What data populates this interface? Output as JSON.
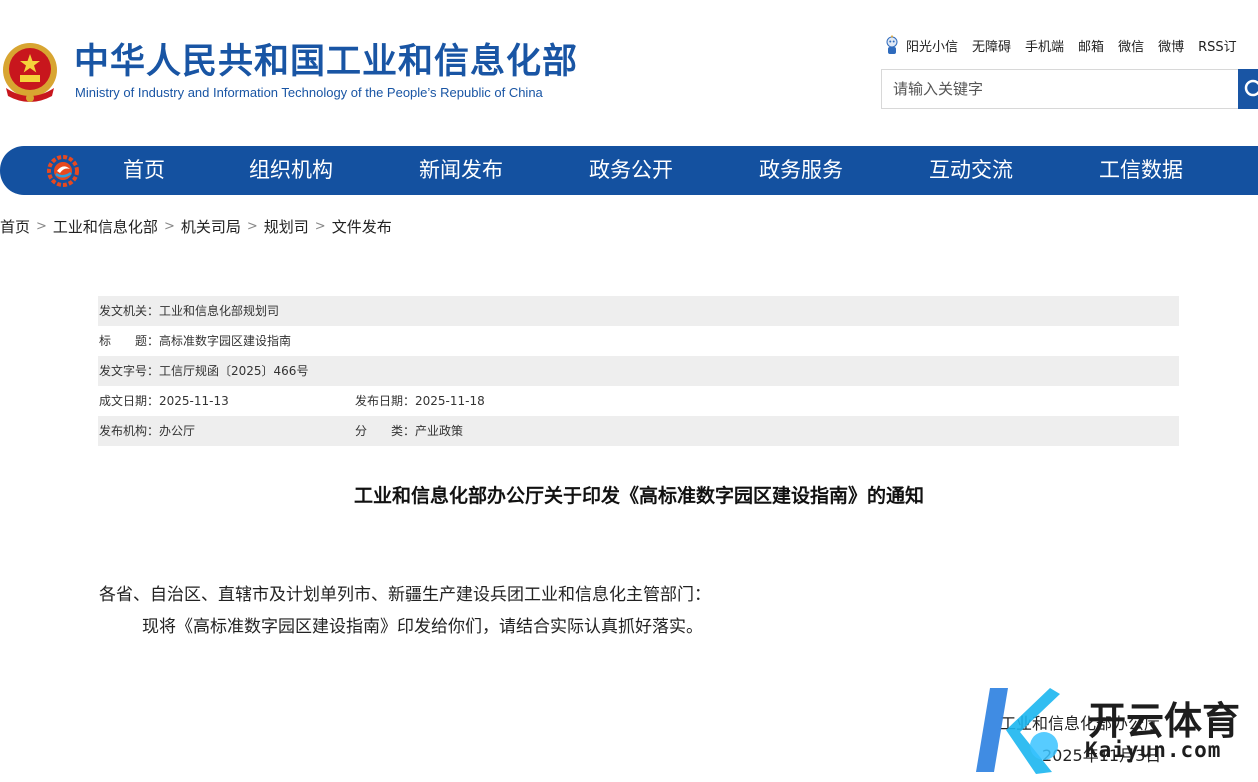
{
  "header": {
    "title": "中华人民共和国工业和信息化部",
    "subtitle": "Ministry of Industry and Information Technology of the People’s Republic of China",
    "top_links": [
      "阳光小信",
      "无障碍",
      "手机端",
      "邮箱",
      "微信",
      "微博",
      "RSS订"
    ]
  },
  "search": {
    "placeholder": "请输入关键字"
  },
  "nav": {
    "items": [
      "首页",
      "组织机构",
      "新闻发布",
      "政务公开",
      "政务服务",
      "互动交流",
      "工信数据"
    ]
  },
  "breadcrumb": [
    "首页",
    "工业和信息化部",
    "机关司局",
    "规划司",
    "文件发布"
  ],
  "info": {
    "issuer": "发文机关：工业和信息化部规划司",
    "title": "标　　题：高标准数字园区建设指南",
    "doc_no": "发文字号：工信厅规函〔2025〕466号",
    "created": "成文日期：2025-11-13",
    "published": "发布日期：2025-11-18",
    "org": "发布机构：办公厅",
    "category": "分　　类：产业政策"
  },
  "article": {
    "title": "工业和信息化部办公厅关于印发《高标准数字园区建设指南》的通知",
    "recipients": "各省、自治区、直辖市及计划单列市、新疆生产建设兵团工业和信息化主管部门：",
    "body": "现将《高标准数字园区建设指南》印发给你们，请结合实际认真抓好落实。",
    "signer": "工业和信息化部办公厅",
    "date": "2025年11月3日"
  },
  "watermark": {
    "text": "开云体育",
    "domain": "Kaiyun.com"
  },
  "colors": {
    "brand_blue": "#1955a4",
    "nav_blue": "#1451a0",
    "row_shade": "#eeeeee"
  }
}
